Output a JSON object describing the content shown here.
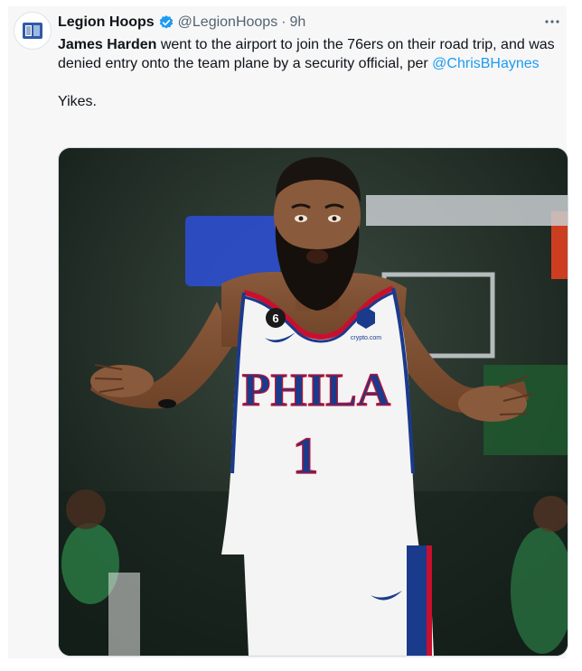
{
  "tweet": {
    "author_name": "Legion Hoops",
    "author_handle": "@LegionHoops",
    "separator": "·",
    "time": "9h",
    "more_icon": "more-horizontal-icon",
    "verified_icon": "verified-badge-icon",
    "text_bold": "James Harden",
    "text_rest": " went to the airport to join the 76ers on their road trip, and was denied entry onto the team plane by a security official, per ",
    "mention": "@ChrisBHaynes",
    "text_end": "Yikes.",
    "jersey_brand": "PHILA",
    "jersey_number": "1",
    "patch_number": "6",
    "sponsor": "crypto.com"
  },
  "colors": {
    "link": "#1d9bf0",
    "verified": "#1d9bf0",
    "muted": "#536471",
    "jersey_text": "#1a3a8c",
    "jersey_trim": "#c8102e"
  }
}
